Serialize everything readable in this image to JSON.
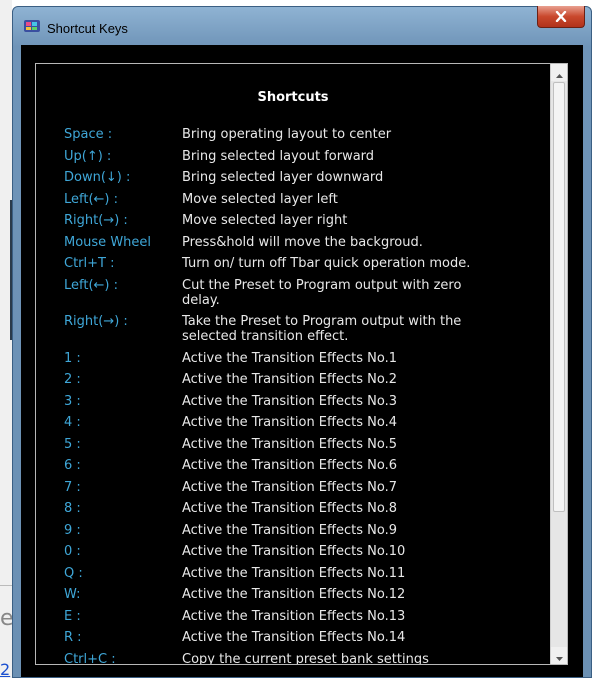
{
  "window": {
    "title": "Shortcut Keys"
  },
  "panel": {
    "heading": "Shortcuts"
  },
  "shortcuts": [
    {
      "key": "Space :",
      "desc": "Bring operating layout to center"
    },
    {
      "key": "Up(↑) :",
      "desc": "Bring selected layout forward"
    },
    {
      "key": "Down(↓) :",
      "desc": "Bring selected layer downward"
    },
    {
      "key": "Left(←) :",
      "desc": "Move selected layer left"
    },
    {
      "key": "Right(→) :",
      "desc": "Move selected layer right"
    },
    {
      "key": "Mouse Wheel",
      "desc": "Press&hold will move the backgroud."
    },
    {
      "key": "Ctrl+T :",
      "desc": "Turn on/ turn off Tbar quick operation mode."
    },
    {
      "key": "Left(←) :",
      "desc": "Cut the Preset to Program output with zero delay."
    },
    {
      "key": "Right(→) :",
      "desc": "Take the Preset to Program output with the selected transition effect."
    },
    {
      "key": "1 :",
      "desc": "Active the Transition Effects No.1"
    },
    {
      "key": "2 :",
      "desc": "Active the Transition Effects No.2"
    },
    {
      "key": "3 :",
      "desc": "Active the Transition Effects No.3"
    },
    {
      "key": "4 :",
      "desc": "Active the Transition Effects No.4"
    },
    {
      "key": "5 :",
      "desc": "Active the Transition Effects No.5"
    },
    {
      "key": "6 :",
      "desc": "Active the Transition Effects No.6"
    },
    {
      "key": "7 :",
      "desc": "Active the Transition Effects No.7"
    },
    {
      "key": "8 :",
      "desc": "Active the Transition Effects No.8"
    },
    {
      "key": "9 :",
      "desc": "Active the Transition Effects No.9"
    },
    {
      "key": "0 :",
      "desc": "Active the Transition Effects No.10"
    },
    {
      "key": "Q :",
      "desc": "Active the Transition Effects No.11"
    },
    {
      "key": "W:",
      "desc": "Active the Transition Effects No.12"
    },
    {
      "key": "E :",
      "desc": "Active the Transition Effects No.13"
    },
    {
      "key": "R :",
      "desc": "Active the Transition Effects No.14"
    },
    {
      "key": "Ctrl+C :",
      "desc": "Copy the current preset bank settings"
    }
  ],
  "background": {
    "fragment_e": "e",
    "fragment_2": "2"
  },
  "colors": {
    "key_text": "#3fa7d8",
    "desc_text": "#e8e8e8",
    "panel_bg": "#000000",
    "close_red": "#c9482d"
  },
  "icons": {
    "app": "app-logo-icon",
    "close": "close-icon",
    "scroll_up": "arrow-up-icon",
    "scroll_down": "arrow-down-icon"
  }
}
